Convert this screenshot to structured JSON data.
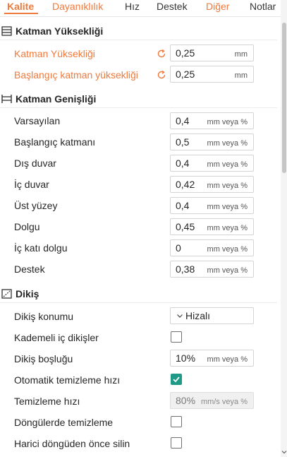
{
  "tabs": [
    {
      "label": "Kalite",
      "active": true
    },
    {
      "label": "Dayanıklılık"
    },
    {
      "label": "Hız"
    },
    {
      "label": "Destek"
    },
    {
      "label": "Diğer"
    },
    {
      "label": "Notlar"
    }
  ],
  "sections": {
    "layer_height": {
      "icon": "layers-icon",
      "title": "Katman Yüksekliği",
      "rows": [
        {
          "label": "Katman Yüksekliği",
          "value": "0,25",
          "unit": "mm"
        },
        {
          "label": "Başlangıç katman yüksekliği",
          "value": "0,25",
          "unit": "mm"
        }
      ]
    },
    "line_width": {
      "icon": "line-width-icon",
      "title": "Katman Genişliği",
      "rows": [
        {
          "label": "Varsayılan",
          "value": "0,4",
          "unit": "mm veya %"
        },
        {
          "label": "Başlangıç katmanı",
          "value": "0,5",
          "unit": "mm veya %"
        },
        {
          "label": "Dış duvar",
          "value": "0,4",
          "unit": "mm veya %"
        },
        {
          "label": "İç duvar",
          "value": "0,42",
          "unit": "mm veya %"
        },
        {
          "label": "Üst yüzey",
          "value": "0,4",
          "unit": "mm veya %"
        },
        {
          "label": "Dolgu",
          "value": "0,45",
          "unit": "mm veya %"
        },
        {
          "label": "İç katı dolgu",
          "value": "0",
          "unit": "mm veya %"
        },
        {
          "label": "Destek",
          "value": "0,38",
          "unit": "mm veya %"
        }
      ]
    },
    "seam": {
      "icon": "seam-icon",
      "title": "Dikiş",
      "rows": [
        {
          "label": "Dikiş konumu",
          "value": "Hizalı"
        },
        {
          "label": "Kademeli iç dikişler",
          "checked": false
        },
        {
          "label": "Dikiş boşluğu",
          "value": "10%",
          "unit": "mm veya %"
        },
        {
          "label": "Otomatik temizleme hızı",
          "checked": true
        },
        {
          "label": "Temizleme hızı",
          "value": "80%",
          "unit": "mm/s veya %"
        },
        {
          "label": "Döngülerde temizleme",
          "checked": false
        },
        {
          "label": "Harici döngüden önce silin",
          "checked": false
        }
      ]
    }
  },
  "colors": {
    "accent": "#f07a3c",
    "checkbox_on": "#1e9a86",
    "text": "#262626"
  }
}
